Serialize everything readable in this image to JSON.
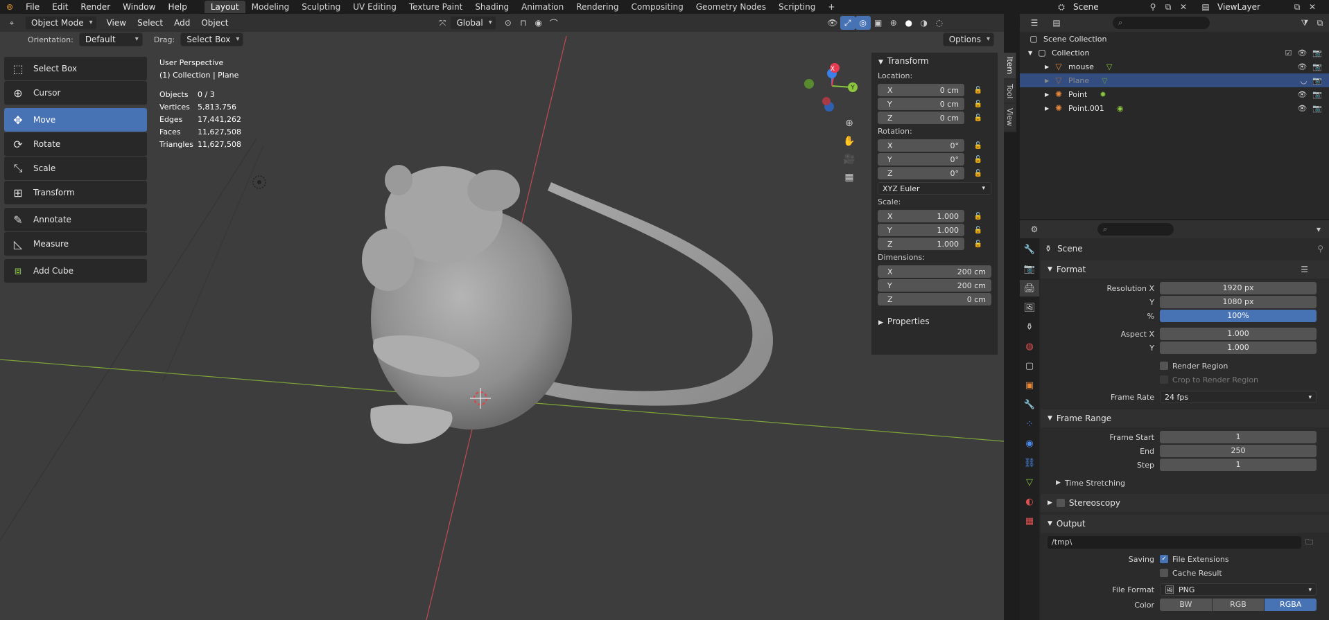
{
  "menu": {
    "items": [
      "File",
      "Edit",
      "Render",
      "Window",
      "Help"
    ]
  },
  "workspaces": {
    "tabs": [
      "Layout",
      "Modeling",
      "Sculpting",
      "UV Editing",
      "Texture Paint",
      "Shading",
      "Animation",
      "Rendering",
      "Compositing",
      "Geometry Nodes",
      "Scripting"
    ],
    "active": "Layout",
    "add": "+"
  },
  "topright": {
    "scene": "Scene",
    "view_layer": "ViewLayer"
  },
  "viewport": {
    "mode": "Object Mode",
    "menus": [
      "View",
      "Select",
      "Add",
      "Object"
    ],
    "transform_orientation": "Global",
    "orientation_label": "Orientation:",
    "orientation_value": "Default",
    "drag_label": "Drag:",
    "drag_value": "Select Box",
    "options": "Options",
    "perspective": "User Perspective",
    "collection_path": "(1) Collection | Plane",
    "stats": [
      {
        "k": "Objects",
        "v": "0 / 3"
      },
      {
        "k": "Vertices",
        "v": "5,813,756"
      },
      {
        "k": "Edges",
        "v": "17,441,262"
      },
      {
        "k": "Faces",
        "v": "11,627,508"
      },
      {
        "k": "Triangles",
        "v": "11,627,508"
      }
    ],
    "gizmo": {
      "x": "X",
      "y": "Y",
      "z": "Z"
    }
  },
  "tools": [
    {
      "label": "Select Box",
      "icon": "select-box-icon",
      "glyph": "⬚"
    },
    {
      "label": "Cursor",
      "icon": "cursor-icon",
      "glyph": "⊕"
    },
    {
      "label": "Move",
      "icon": "move-icon",
      "glyph": "✥",
      "active": true
    },
    {
      "label": "Rotate",
      "icon": "rotate-icon",
      "glyph": "⟳"
    },
    {
      "label": "Scale",
      "icon": "scale-icon",
      "glyph": "⤡"
    },
    {
      "label": "Transform",
      "icon": "transform-icon",
      "glyph": "⊞"
    },
    {
      "label": "Annotate",
      "icon": "annotate-icon",
      "glyph": "✎"
    },
    {
      "label": "Measure",
      "icon": "measure-icon",
      "glyph": "📐"
    },
    {
      "label": "Add Cube",
      "icon": "add-cube-icon",
      "glyph": "⧈"
    }
  ],
  "npanel": {
    "title": "Transform",
    "location_label": "Location:",
    "location": [
      {
        "axis": "X",
        "value": "0 cm"
      },
      {
        "axis": "Y",
        "value": "0 cm"
      },
      {
        "axis": "Z",
        "value": "0 cm"
      }
    ],
    "rotation_label": "Rotation:",
    "rotation": [
      {
        "axis": "X",
        "value": "0°"
      },
      {
        "axis": "Y",
        "value": "0°"
      },
      {
        "axis": "Z",
        "value": "0°"
      }
    ],
    "rotation_mode": "XYZ Euler",
    "scale_label": "Scale:",
    "scale": [
      {
        "axis": "X",
        "value": "1.000"
      },
      {
        "axis": "Y",
        "value": "1.000"
      },
      {
        "axis": "Z",
        "value": "1.000"
      }
    ],
    "dimensions_label": "Dimensions:",
    "dimensions": [
      {
        "axis": "X",
        "value": "200 cm"
      },
      {
        "axis": "Y",
        "value": "200 cm"
      },
      {
        "axis": "Z",
        "value": "0 cm"
      }
    ],
    "properties": "Properties",
    "tabs": [
      "Item",
      "Tool",
      "View"
    ]
  },
  "outliner": {
    "scene_collection": "Scene Collection",
    "collection": "Collection",
    "items": [
      {
        "name": "mouse",
        "icon": "mesh-icon",
        "glyph": "▽",
        "color": "#e6883c"
      },
      {
        "name": "Plane",
        "icon": "mesh-icon",
        "glyph": "▽",
        "color": "#e6883c",
        "selected": true
      },
      {
        "name": "Point",
        "icon": "light-icon",
        "glyph": "✺",
        "color": "#e6883c"
      },
      {
        "name": "Point.001",
        "icon": "light-icon",
        "glyph": "✺",
        "color": "#e6883c"
      }
    ]
  },
  "properties": {
    "context": "Scene",
    "format": {
      "title": "Format",
      "rows": [
        {
          "label": "Resolution X",
          "value": "1920 px"
        },
        {
          "label": "Y",
          "value": "1080 px"
        },
        {
          "label": "%",
          "value": "100%",
          "blue": true
        },
        {
          "label": "Aspect X",
          "value": "1.000"
        },
        {
          "label": "Y",
          "value": "1.000"
        }
      ],
      "render_region": "Render Region",
      "crop": "Crop to Render Region",
      "frame_rate_label": "Frame Rate",
      "frame_rate": "24 fps"
    },
    "frame_range": {
      "title": "Frame Range",
      "rows": [
        {
          "label": "Frame Start",
          "value": "1"
        },
        {
          "label": "End",
          "value": "250"
        },
        {
          "label": "Step",
          "value": "1"
        }
      ],
      "time_stretching": "Time Stretching"
    },
    "stereoscopy": "Stereoscopy",
    "output": {
      "title": "Output",
      "path": "/tmp\\",
      "saving_label": "Saving",
      "file_extensions": "File Extensions",
      "cache_result": "Cache Result",
      "file_format_label": "File Format",
      "file_format": "PNG",
      "color_label": "Color",
      "color_options": [
        "BW",
        "RGB",
        "RGBA"
      ],
      "color_active": "RGBA"
    }
  },
  "colors": {
    "accent": "#4772b3",
    "x_axis": "#e83b4f",
    "y_axis": "#8cc63f",
    "z_axis": "#3b80e8"
  }
}
